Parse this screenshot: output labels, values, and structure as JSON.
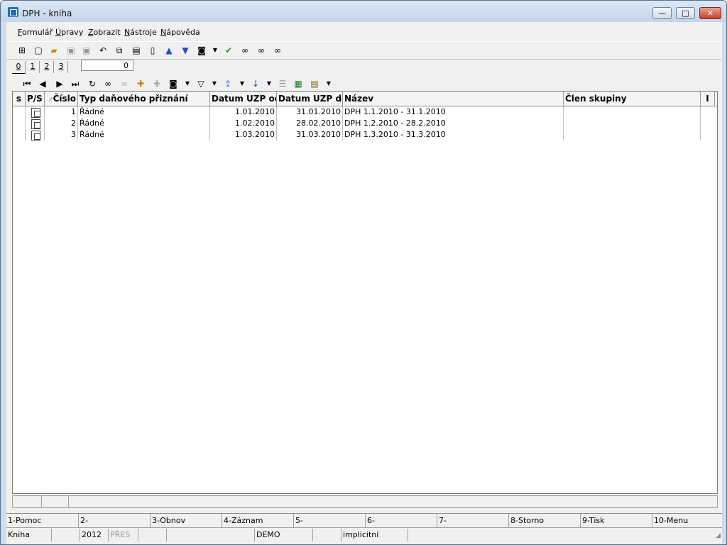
{
  "window": {
    "title": "DPH - kniha",
    "minimize_glyph": "—",
    "maximize_glyph": "□",
    "close_glyph": "✕"
  },
  "menu": [
    "Formulář",
    "Úpravy",
    "Zobrazit",
    "Nástroje",
    "Nápověda"
  ],
  "toolbar_icons": [
    "tree-icon",
    "new-document-icon",
    "open-folder-icon",
    "save-icon",
    "save-as-icon",
    "undo-icon",
    "copy-icon",
    "paste-icon",
    "book-icon",
    "arrow-up-icon",
    "arrow-down-icon",
    "camera-icon",
    "dropdown-arrow-icon",
    "green-check-icon",
    "binoculars-icon",
    "find-next-icon",
    "find-replace-icon"
  ],
  "tabs": [
    "0",
    "1",
    "2",
    "3"
  ],
  "tab_counter": "0",
  "nav_icons": [
    "first-record-icon",
    "previous-record-icon",
    "next-record-icon",
    "last-record-icon",
    "refresh-icon",
    "search-icon",
    "search-disabled-icon",
    "add-row-icon",
    "remove-row-icon",
    "camera-icon",
    "filter-icon",
    "export-icon",
    "sort-az-icon",
    "columns-icon",
    "excel-icon",
    "report-icon"
  ],
  "grid": {
    "columns": [
      "s",
      "P/S",
      "Číslo",
      "Typ daňového přiznání",
      "Datum UZP od",
      "Datum UZP do",
      "Název",
      "Člen skupiny",
      "I"
    ],
    "rows": [
      {
        "cislo": "1",
        "typ": "Řádné",
        "od": "1.01.2010",
        "do": "31.01.2010",
        "nazev": "DPH 1.1.2010 - 31.1.2010"
      },
      {
        "cislo": "2",
        "typ": "Řádné",
        "od": "1.02.2010",
        "do": "28.02.2010",
        "nazev": "DPH 1.2.2010 - 28.2.2010"
      },
      {
        "cislo": "3",
        "typ": "Řádné",
        "od": "1.03.2010",
        "do": "31.03.2010",
        "nazev": "DPH 1.3.2010 - 31.3.2010"
      }
    ]
  },
  "fkeys": [
    "1-Pomoc",
    "2-",
    "3-Obnov",
    "4-Záznam",
    "5-",
    "6-",
    "7-",
    "8-Storno",
    "9-Tisk",
    "10-Menu"
  ],
  "status": {
    "module": "Kniha",
    "year": "2012",
    "mode": "PŘES",
    "database": "DEMO",
    "profile": "implicitní"
  }
}
